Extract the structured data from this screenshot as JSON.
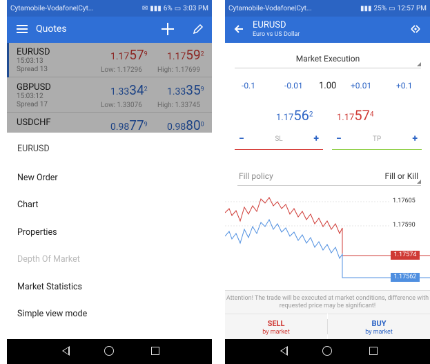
{
  "left": {
    "statusbar": {
      "carrier": "Cytamobile-Vodafone|Cyt...",
      "battery": "6%",
      "time": "3:03 PM"
    },
    "appbar": {
      "title": "Quotes"
    },
    "quotes": [
      {
        "symbol": "EURUSD",
        "time": "15:03:13",
        "spread": "Spread 13",
        "bid_prefix": "1.17",
        "bid_big": "57",
        "bid_sup": "9",
        "ask_prefix": "1.17",
        "ask_big": "59",
        "ask_sup": "2",
        "low": "Low: 1.17296",
        "high": "High: 1.17699"
      },
      {
        "symbol": "GBPUSD",
        "time": "15:03:12",
        "spread": "Spread 17",
        "bid_prefix": "1.33",
        "bid_big": "34",
        "bid_sup": "2",
        "ask_prefix": "1.33",
        "ask_big": "35",
        "ask_sup": "9",
        "low": "Low: 1.33076",
        "high": "High: 1.33745"
      },
      {
        "symbol": "USDCHF",
        "time": "",
        "spread": "",
        "bid_prefix": "0.98",
        "bid_big": "77",
        "bid_sup": "9",
        "ask_prefix": "0.98",
        "ask_big": "80",
        "ask_sup": "0",
        "low": "",
        "high": ""
      }
    ],
    "menu": {
      "header": "EURUSD",
      "items": [
        {
          "label": "New Order",
          "enabled": true
        },
        {
          "label": "Chart",
          "enabled": true
        },
        {
          "label": "Properties",
          "enabled": true
        },
        {
          "label": "Depth Of Market",
          "enabled": false
        },
        {
          "label": "Market Statistics",
          "enabled": true
        },
        {
          "label": "Simple view mode",
          "enabled": true
        }
      ]
    }
  },
  "right": {
    "statusbar": {
      "carrier": "Cytamobile-Vodafone|Cyt...",
      "battery": "25%",
      "time": "12:57 PM"
    },
    "appbar": {
      "title": "EURUSD",
      "subtitle": "Euro vs US Dollar"
    },
    "execution": "Market Execution",
    "volume_steps": [
      "-0.1",
      "-0.01",
      "1.00",
      "+0.01",
      "+0.1"
    ],
    "bid": {
      "prefix": "1.17",
      "big": "56",
      "sup": "2"
    },
    "ask": {
      "prefix": "1.17",
      "big": "57",
      "sup": "4"
    },
    "sl": {
      "minus": "−",
      "label": "SL",
      "plus": "+"
    },
    "tp": {
      "minus": "−",
      "label": "TP",
      "plus": "+"
    },
    "fill_policy": {
      "label": "Fill policy",
      "value": "Fill or Kill"
    },
    "chart_ticks": [
      "1.17605",
      "1.17590"
    ],
    "price_tags": {
      "ask": "1.17574",
      "bid": "1.17562"
    },
    "warning": "Attention! The trade will be executed at market conditions, difference with requested price may be significant!",
    "sell": {
      "title": "SELL",
      "sub": "by market"
    },
    "buy": {
      "title": "BUY",
      "sub": "by market"
    }
  },
  "colors": {
    "appbar": "#2f6fd6",
    "statusbar": "#2b64c3",
    "sell": "#cf3a35",
    "buy": "#2b63c5",
    "sl_line": "#d63a36",
    "tp_line": "#8fcf46"
  },
  "icons": {
    "menu": "hamburger-icon",
    "add": "plus-icon",
    "edit": "pencil-icon",
    "back": "arrow-left-icon",
    "one_click": "one-click-trading-icon"
  }
}
